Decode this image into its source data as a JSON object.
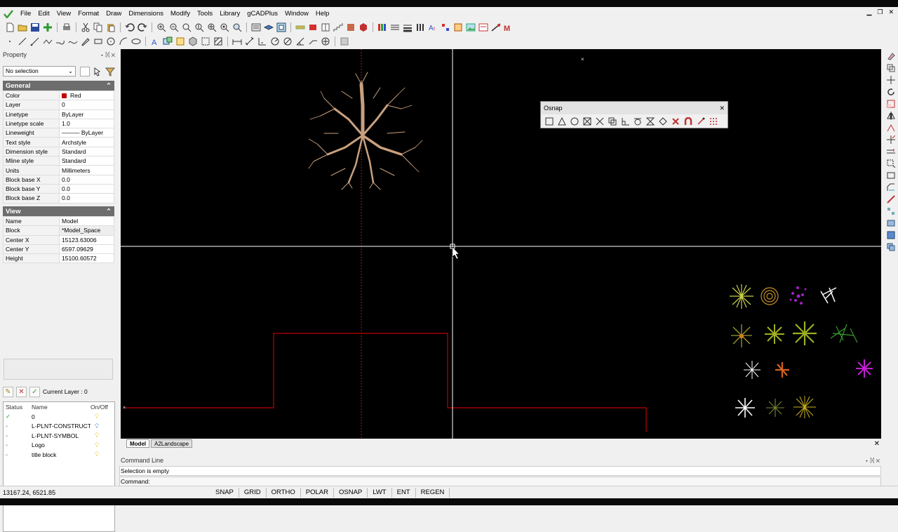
{
  "menubar": {
    "items": [
      "File",
      "Edit",
      "View",
      "Format",
      "Draw",
      "Dimensions",
      "Modify",
      "Tools",
      "Library",
      "gCADPlus",
      "Window",
      "Help"
    ]
  },
  "property": {
    "title": "Property",
    "selection": "No selection",
    "general_title": "General",
    "general": [
      {
        "key": "Color",
        "value": "Red"
      },
      {
        "key": "Layer",
        "value": "0"
      },
      {
        "key": "Linetype",
        "value": "ByLayer"
      },
      {
        "key": "Linetype scale",
        "value": "1.0"
      },
      {
        "key": "Lineweight",
        "value": "——— ByLayer"
      },
      {
        "key": "Text style",
        "value": "Archstyle"
      },
      {
        "key": "Dimension style",
        "value": "Standard"
      },
      {
        "key": "Mline style",
        "value": "Standard"
      },
      {
        "key": "Units",
        "value": "Millimeters"
      },
      {
        "key": "Block base X",
        "value": "0.0"
      },
      {
        "key": "Block base Y",
        "value": "0.0"
      },
      {
        "key": "Block base Z",
        "value": "0.0"
      }
    ],
    "view_title": "View",
    "view": [
      {
        "key": "Name",
        "value": "Model"
      },
      {
        "key": "Block",
        "value": "*Model_Space"
      },
      {
        "key": "Center X",
        "value": "15123.63006"
      },
      {
        "key": "Center Y",
        "value": "6597.09629"
      },
      {
        "key": "Height",
        "value": "15100.60572"
      }
    ]
  },
  "layers": {
    "current": "Current Layer : 0",
    "headers": {
      "status": "Status",
      "name": "Name",
      "onoff": "On/Off"
    },
    "rows": [
      {
        "status": "✓",
        "name": "0"
      },
      {
        "status": "◦",
        "name": "L-PLNT-CONSTRUCT"
      },
      {
        "status": "◦",
        "name": "L-PLNT-SYMBOL"
      },
      {
        "status": "◦",
        "name": "Logo"
      },
      {
        "status": "◦",
        "name": "title block"
      }
    ]
  },
  "osnap": {
    "title": "Osnap"
  },
  "tabs": [
    "Model",
    "A2Landscape"
  ],
  "command": {
    "title": "Command Line",
    "history": "Selection is empty",
    "prompt": "Command:"
  },
  "status": {
    "coords": "13167.24, 6521.85",
    "buttons": [
      "SNAP",
      "GRID",
      "ORTHO",
      "POLAR",
      "OSNAP",
      "LWT",
      "ENT",
      "REGEN"
    ]
  },
  "colors": {
    "canvas": "#000000",
    "accent_red": "#c00000",
    "tree": "#c9a07e",
    "section": "#6d6d6d"
  }
}
